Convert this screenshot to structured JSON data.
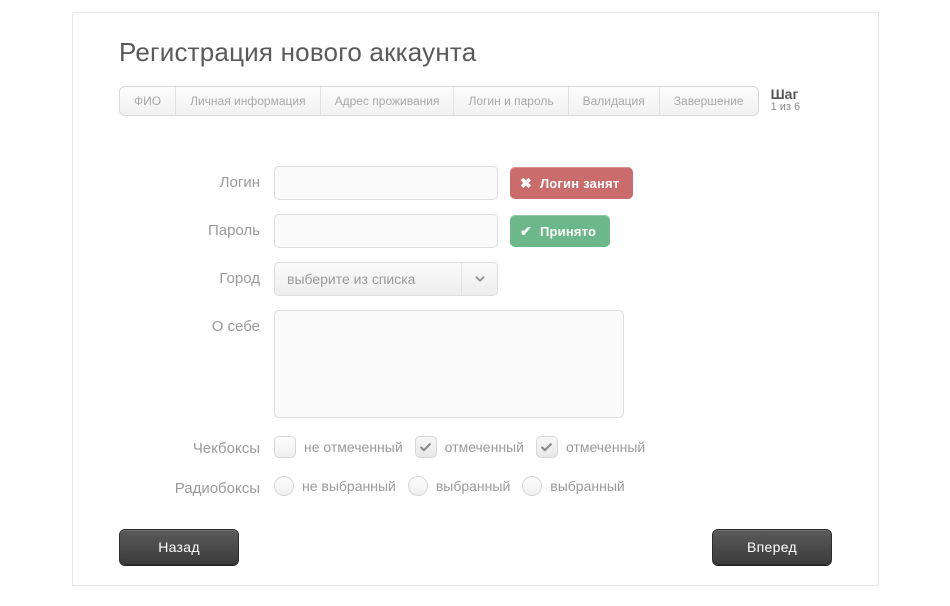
{
  "title": "Регистрация нового аккаунта",
  "steps": {
    "items": [
      "ФИО",
      "Личная информация",
      "Адрес проживания",
      "Логин и пароль",
      "Валидация",
      "Завершение"
    ],
    "meta_label": "Шаг",
    "meta_progress": "1 из 6"
  },
  "form": {
    "login": {
      "label": "Логин",
      "value": "",
      "badge": "Логин занят"
    },
    "password": {
      "label": "Пароль",
      "value": "",
      "badge": "Принято"
    },
    "city": {
      "label": "Город",
      "placeholder": "выберите из списка"
    },
    "about": {
      "label": "О себе",
      "value": ""
    },
    "checkboxes": {
      "label": "Чекбоксы",
      "items": [
        {
          "label": "не отмеченный",
          "checked": false
        },
        {
          "label": "отмеченный",
          "checked": true
        },
        {
          "label": "отмеченный",
          "checked": true
        }
      ]
    },
    "radios": {
      "label": "Радиобоксы",
      "items": [
        {
          "label": "не выбранный",
          "selected": false
        },
        {
          "label": "выбранный",
          "selected": false
        },
        {
          "label": "выбранный",
          "selected": false
        }
      ]
    }
  },
  "buttons": {
    "back": "Назад",
    "next": "Вперед"
  }
}
